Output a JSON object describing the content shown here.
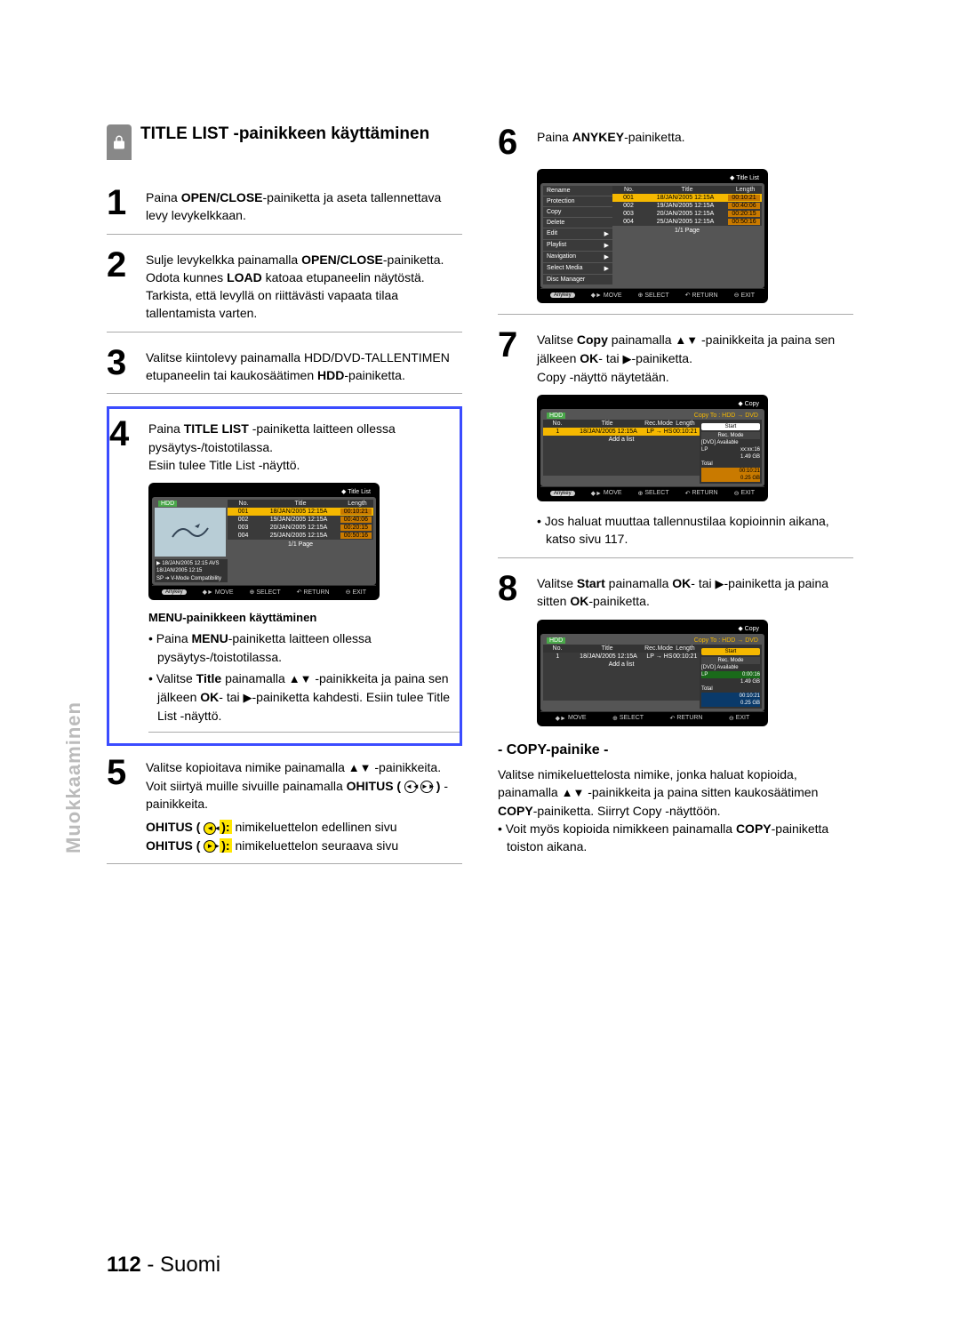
{
  "page": {
    "number": "112",
    "lang": "Suomi"
  },
  "sidebar": {
    "label": "Muokkaaminen"
  },
  "section_title": "TITLE LIST -painikkeen käyttäminen",
  "steps": {
    "s1": "Paina <b>OPEN/CLOSE</b>-painiketta ja aseta tallennettava levy levykelkkaan.",
    "s2": "Sulje levykelkka painamalla <b>OPEN/CLOSE</b>-painiketta. Odota kunnes <b>LOAD</b> katoaa etupaneelin näytöstä. Tarkista, että levyllä on riittävästi vapaata tilaa tallentamista varten.",
    "s3": "Valitse kiintolevy painamalla HDD/DVD-TALLENTIMEN etupaneelin tai kaukosäätimen <b>HDD</b>-painiketta.",
    "s4a": "Paina <b>TITLE LIST</b> -painiketta laitteen ollessa pysäytys-/toistotilassa.",
    "s4b": "Esiin tulee Title List -näyttö.",
    "menu_head": "MENU-painikkeen käyttäminen",
    "menu_b1": "Paina <b>MENU</b>-painiketta laitteen ollessa pysäytys-/toistotilassa.",
    "menu_b2": "Valitse <b>Title</b> painamalla <span class='tri'>▲▼</span> -painikkeita ja paina sen jälkeen <b>OK</b>- tai <span class='tri'>▶</span>-painiketta kahdesti. Esiin tulee Title List -näyttö.",
    "s5a": "Valitse kopioitava nimike painamalla <span class='tri'>▲▼</span> -painikkeita.",
    "s5b": "Voit siirtyä muille sivuille painamalla <b>OHITUS (</b> <span class='circ-btn'>◄◄</span> <span class='circ-btn'>►►</span> <b>)</b> -painikkeita.",
    "s5c": "<b>OHITUS (</b> <span class='circ-btn hl'>◄◄</span> <b><span class='hl'>):</span></b> nimikeluettelon edellinen sivu",
    "s5d": "<b>OHITUS (</b> <span class='circ-btn hl'>►►</span> <b><span class='hl'>):</span></b> nimikeluettelon seuraava sivu",
    "s6": "Paina <b>ANYKEY</b>-painiketta.",
    "s7a": "Valitse <b>Copy</b> painamalla <span class='tri'>▲▼</span> -painikkeita ja paina sen jälkeen <b>OK</b>- tai <span class='tri'>▶</span>-painiketta.",
    "s7b": "Copy -näyttö näytetään.",
    "s7_bullet": "Jos haluat muuttaa tallennustilaa kopioinnin aikana, katso sivu 117.",
    "s8": "Valitse <b>Start</b> painamalla <b>OK</b>- tai <span class='tri'>▶</span>-painiketta ja paina sitten <b>OK</b>-painiketta."
  },
  "copy_section": {
    "head": "- COPY-painike -",
    "p1": "Valitse nimikeluettelosta nimike, jonka haluat kopioida, painamalla <span class='tri'>▲▼</span> -painikkeita ja paina sitten kaukosäätimen <b>COPY</b>-painiketta. Siirryt Copy -näyttöön.",
    "b1": "Voit myös kopioida nimikkeen painamalla <b>COPY</b>-painiketta toiston aikana."
  },
  "osd_titlelist": {
    "title": "Title List",
    "hdd": "HDD",
    "cols": {
      "no": "No.",
      "title": "Title",
      "len": "Length"
    },
    "rows": [
      {
        "no": "001",
        "title": "18/JAN/2005 12:15A",
        "len": "00:10:21",
        "sel": true
      },
      {
        "no": "002",
        "title": "19/JAN/2005 12:15A",
        "len": "00:40:06",
        "sel": false
      },
      {
        "no": "003",
        "title": "20/JAN/2005 12:15A",
        "len": "00:20:15",
        "sel": false
      },
      {
        "no": "004",
        "title": "25/JAN/2005 12:15A",
        "len": "00:50:16",
        "sel": false
      }
    ],
    "prev1": "18/JAN/2005 12:15 AVS",
    "prev2": "18/JAN/2005 12:15",
    "prev3": "SP ➔ V-Mode Compatibility",
    "pager": "1/1 Page",
    "footer": {
      "anykey": "Anykey",
      "move": "MOVE",
      "select": "SELECT",
      "return": "RETURN",
      "exit": "EXIT"
    }
  },
  "osd_menu": {
    "items": [
      "Rename",
      "Protection",
      "Copy",
      "Delete",
      "Edit",
      "Playlist",
      "Navigation",
      "Select Media",
      "Disc Manager"
    ]
  },
  "osd_copy": {
    "title": "Copy",
    "copyto": "Copy To : HDD → DVD",
    "cols": {
      "no": "No.",
      "title": "Title",
      "rec": "Rec.Mode",
      "len": "Length"
    },
    "row1": {
      "no": "1",
      "title": "18/JAN/2005 12:15A",
      "rec": "LP → HS",
      "len": "00:10:21"
    },
    "add": "Add a list",
    "side": {
      "avail": "[DVD] Available",
      "mode": "LP",
      "mode_t": "xx:xx:16",
      "size": "1.49 GB",
      "total": "Total",
      "tot_t": "00:10:21",
      "tot_s": "0.25 GB",
      "start": "Start",
      "recmode": "Rec. Mode"
    }
  }
}
